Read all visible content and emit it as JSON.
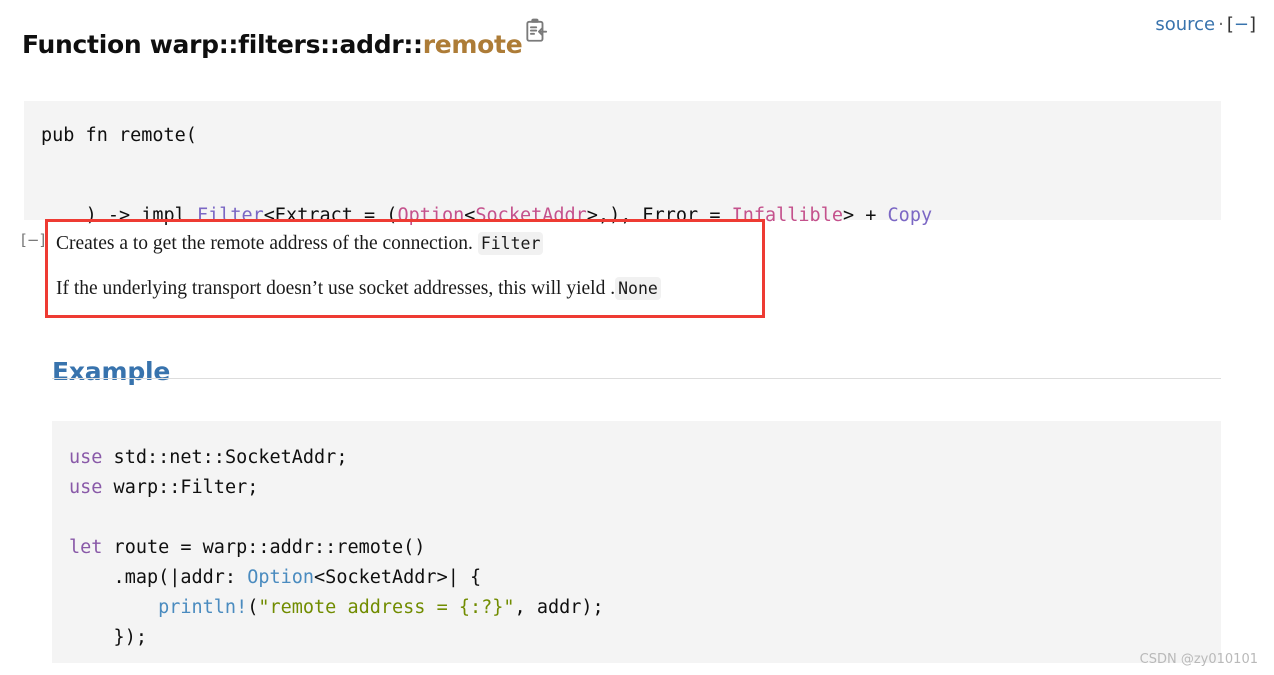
{
  "header": {
    "title_prefix": "Function warp::filters::addr::",
    "title_fn": "remote",
    "copy_icon": "copy-clipboard-icon",
    "source_label": "source",
    "separator": "·",
    "collapse_toggle_open": "[",
    "collapse_toggle_minus": "−",
    "collapse_toggle_close": "]"
  },
  "signature": {
    "line1": "pub fn remote(",
    "line2_parts": [
      {
        "text": ") -> impl ",
        "token": "plain"
      },
      {
        "text": "Filter",
        "token": "trait"
      },
      {
        "text": "<Extract = (",
        "token": "plain"
      },
      {
        "text": "Option",
        "token": "type-pink"
      },
      {
        "text": "<",
        "token": "plain"
      },
      {
        "text": "SocketAddr",
        "token": "type-pink"
      },
      {
        "text": ">,), Error = ",
        "token": "plain"
      },
      {
        "text": "Infallible",
        "token": "type-pink"
      },
      {
        "text": "> + ",
        "token": "plain"
      },
      {
        "text": "Copy",
        "token": "trait"
      }
    ],
    "full_text": ") -> impl Filter<Extract = (Option<SocketAddr>,), Error = Infallible> + Copy"
  },
  "doc": {
    "toggle": "[−]",
    "paragraph1_before": "Creates a to get the remote address of the connection.",
    "paragraph1_code": "Filter",
    "paragraph2_before": "If the underlying transport doesn’t use socket addresses, this will yield .",
    "paragraph2_code": "None",
    "highlight_color": "#ee3b33"
  },
  "example": {
    "heading": "Example",
    "code_lines": [
      [
        {
          "text": "use",
          "token": "keyword"
        },
        {
          "text": " std::net::SocketAddr;",
          "token": "plain"
        }
      ],
      [
        {
          "text": "use",
          "token": "keyword"
        },
        {
          "text": " warp::Filter;",
          "token": "plain"
        }
      ],
      [],
      [
        {
          "text": "let",
          "token": "keyword"
        },
        {
          "text": " route = warp::addr::remote()",
          "token": "plain"
        }
      ],
      [
        {
          "text": "    .map(|addr: ",
          "token": "plain"
        },
        {
          "text": "Option",
          "token": "type-blue"
        },
        {
          "text": "<SocketAddr>| {",
          "token": "plain"
        }
      ],
      [
        {
          "text": "        ",
          "token": "plain"
        },
        {
          "text": "println!",
          "token": "macro"
        },
        {
          "text": "(",
          "token": "plain"
        },
        {
          "text": "\"remote address = {:?}\"",
          "token": "string"
        },
        {
          "text": ", addr);",
          "token": "plain"
        }
      ],
      [
        {
          "text": "    });",
          "token": "plain"
        }
      ]
    ],
    "code_plain": "use std::net::SocketAddr;\nuse warp::Filter;\n\nlet route = warp::addr::remote()\n    .map(|addr: Option<SocketAddr>| {\n        println!(\"remote address = {:?}\", addr);\n    });"
  },
  "watermark": {
    "text": "CSDN @zy010101"
  },
  "colors": {
    "link_blue": "#3873ad",
    "fn_name_amber": "#ad7c37",
    "code_bg": "#f4f4f4",
    "highlight_red": "#ee3b33",
    "keyword_purple": "#8959a8",
    "trait_violet": "#7b67c4",
    "type_pink": "#c4518c",
    "type_blue": "#4a8bbf",
    "string_green": "#718c00"
  }
}
